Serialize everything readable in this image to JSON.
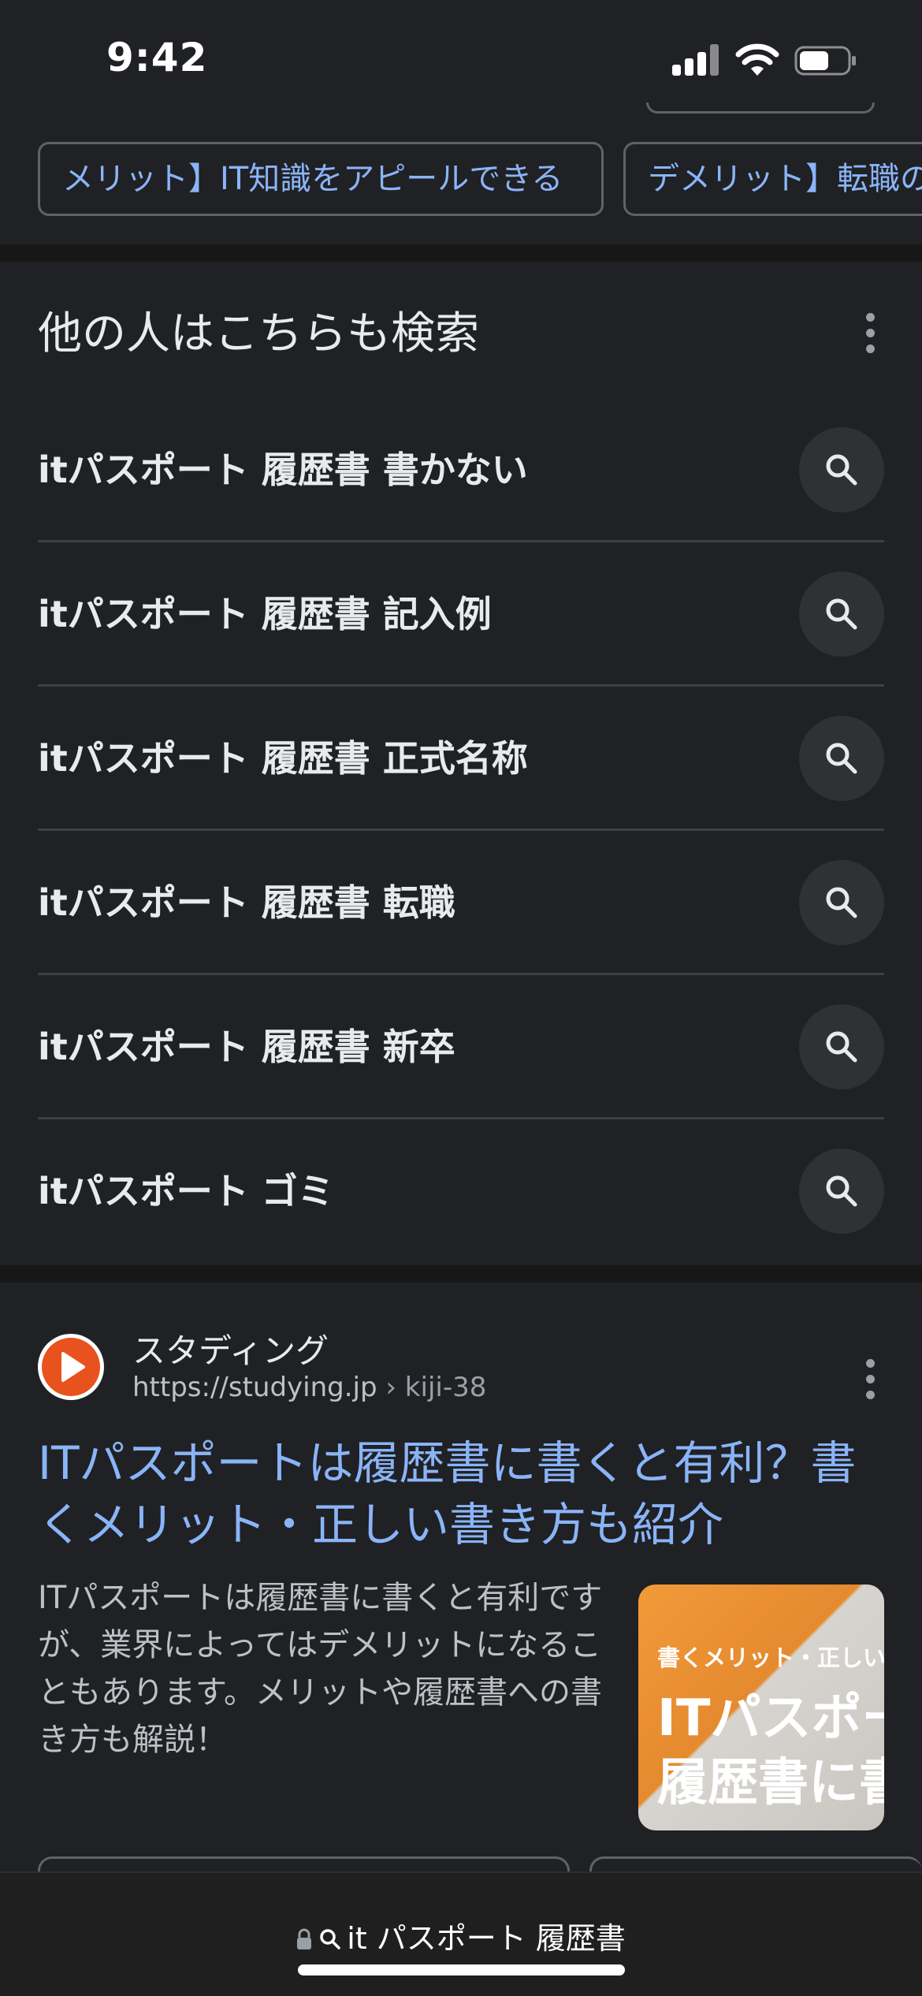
{
  "status_bar": {
    "time": "9:42"
  },
  "chips": [
    {
      "label": "メリット】IT知識をアピールできる"
    },
    {
      "label": "デメリット】転職の"
    }
  ],
  "related_searches": {
    "title": "他の人はこちらも検索",
    "items": [
      {
        "label": "itパスポート 履歴書 書かない"
      },
      {
        "label": "itパスポート 履歴書 記入例"
      },
      {
        "label": "itパスポート 履歴書 正式名称"
      },
      {
        "label": "itパスポート 履歴書 転職"
      },
      {
        "label": "itパスポート 履歴書 新卒"
      },
      {
        "label": "itパスポート ゴミ"
      }
    ]
  },
  "result": {
    "site_name": "スタディング",
    "url": "https://studying.jp",
    "url_path": "› kiji-38",
    "title": "ITパスポートは履歴書に書くと有利？書くメリット・正しい書き方も紹介",
    "snippet": "ITパスポートは履歴書に書くと有利ですが、業界によってはデメリットになることもあります。メリットや履歴書への書き方も解説！",
    "thumbnail": {
      "line1": "書くメリット・正しい書",
      "line2": "ITパスポー",
      "line3": "履歴書に書"
    }
  },
  "address_bar": {
    "query": "it パスポート 履歴書"
  },
  "colors": {
    "background": "#202124",
    "link_blue": "#8ab4f8",
    "divider": "#3c4043",
    "favicon_orange": "#e8521f",
    "thumbnail_orange": "#f29a3a"
  }
}
